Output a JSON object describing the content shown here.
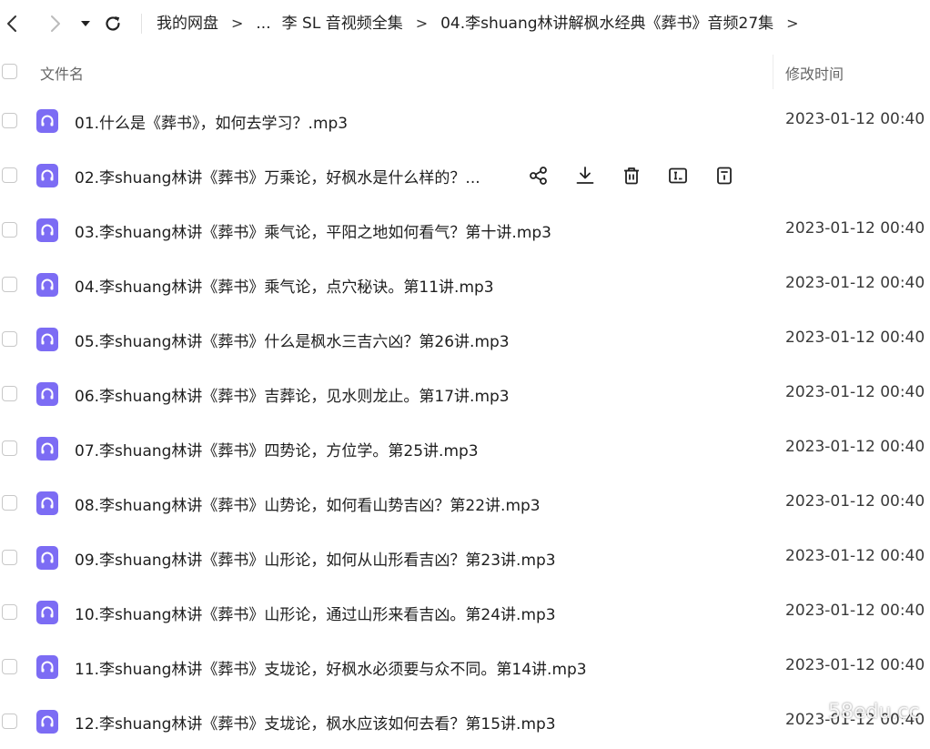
{
  "breadcrumb": {
    "items": [
      "我的网盘",
      "...",
      "李 SL 音视频全集",
      "04.李shuang林讲解枫水经典《葬书》音频27集"
    ],
    "separator": ">"
  },
  "columns": {
    "name": "文件名",
    "modified": "修改时间"
  },
  "files": [
    {
      "name": "01.什么是《葬书》，如何去学习？.mp3",
      "modified": "2023-01-12 00:40"
    },
    {
      "name": "02.李shuang林讲《葬书》万乘论，好枫水是什么样的？...",
      "modified": ""
    },
    {
      "name": "03.李shuang林讲《葬书》乘气论，平阳之地如何看气？第十讲.mp3",
      "modified": "2023-01-12 00:40"
    },
    {
      "name": "04.李shuang林讲《葬书》乘气论，点穴秘诀。第11讲.mp3",
      "modified": "2023-01-12 00:40"
    },
    {
      "name": "05.李shuang林讲《葬书》什么是枫水三吉六凶？第26讲.mp3",
      "modified": "2023-01-12 00:40"
    },
    {
      "name": "06.李shuang林讲《葬书》吉葬论，见水则龙止。第17讲.mp3",
      "modified": "2023-01-12 00:40"
    },
    {
      "name": "07.李shuang林讲《葬书》四势论，方位学。第25讲.mp3",
      "modified": "2023-01-12 00:40"
    },
    {
      "name": "08.李shuang林讲《葬书》山势论，如何看山势吉凶？第22讲.mp3",
      "modified": "2023-01-12 00:40"
    },
    {
      "name": "09.李shuang林讲《葬书》山形论，如何从山形看吉凶？第23讲.mp3",
      "modified": "2023-01-12 00:40"
    },
    {
      "name": "10.李shuang林讲《葬书》山形论，通过山形来看吉凶。第24讲.mp3",
      "modified": "2023-01-12 00:40"
    },
    {
      "name": "11.李shuang林讲《葬书》支垅论，好枫水必须要与众不同。第14讲.mp3",
      "modified": "2023-01-12 00:40"
    },
    {
      "name": "12.李shuang林讲《葬书》支垅论，枫水应该如何去看？第15讲.mp3",
      "modified": "2023-01-12 00:40"
    }
  ],
  "hover_actions": [
    "share-icon",
    "download-icon",
    "delete-icon",
    "rename-icon",
    "details-icon"
  ],
  "watermark": "58edu.cc",
  "colors": {
    "file_icon": "#7c6cf4",
    "text": "#1e1e1e",
    "muted": "#666666"
  }
}
